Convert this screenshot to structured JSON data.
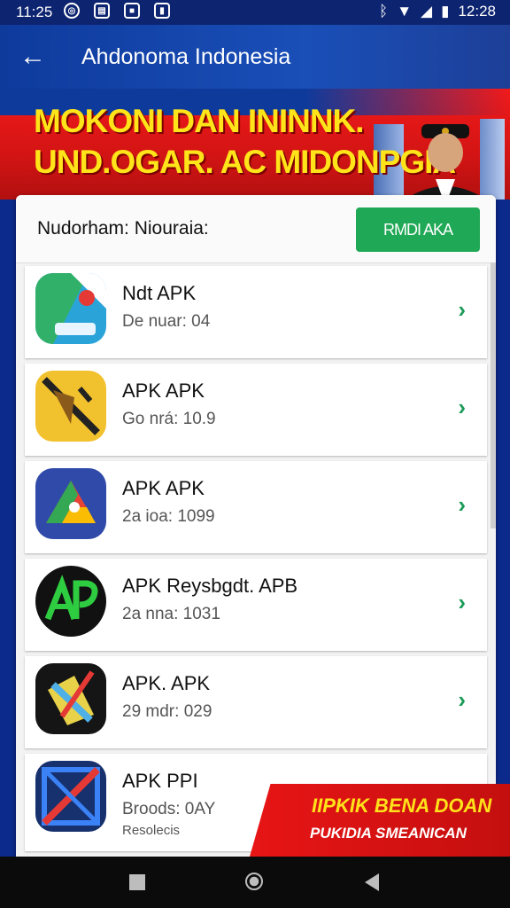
{
  "status_bar": {
    "time_left": "11:25",
    "time_right": "12:28"
  },
  "app_bar": {
    "title": "Ahdonoma Indonesia"
  },
  "banner": {
    "line1": "MOKONI DAN ININNK.",
    "line2": "UND.OGAR. AC MIDONPGIA"
  },
  "card": {
    "label": "Nudorham: Niouraia:",
    "install_button": "RMDI AKA"
  },
  "apps": [
    {
      "name": "Ndt APK",
      "meta": "De nuar: 04",
      "icon": "maps-like-icon"
    },
    {
      "name": "APK APK",
      "meta": "Go nrá: 10.9",
      "icon": "tools-icon"
    },
    {
      "name": "APK APK",
      "meta": "2a ioa: 1099",
      "icon": "drive-like-icon"
    },
    {
      "name": "APK Reysbgdt. APB",
      "meta": "2a nna: 1031",
      "icon": "ap-logo-icon"
    },
    {
      "name": "APK. APK",
      "meta": "29 mdr: 029",
      "icon": "pen-tool-icon"
    },
    {
      "name": "APK PPI",
      "meta": "Broods: 0AY",
      "meta2": "Resolecis",
      "icon": "blue-tool-icon"
    }
  ],
  "ad": {
    "line1": "IIPKIK BENA DOAN",
    "line2": "PUKIDIA SMEANICAN"
  }
}
